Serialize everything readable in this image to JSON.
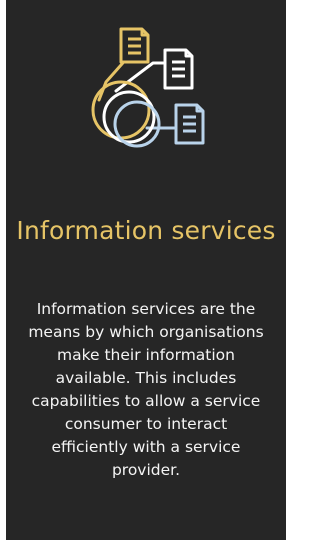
{
  "card": {
    "title": "Information services",
    "description": "Information services are the means by which organisations make their information available. This includes capabilities to allow a service consumer to interact efficiently with a service provider."
  },
  "icon": {
    "name": "information-services-icon",
    "colors": {
      "gold": "#e6c466",
      "white": "#ffffff",
      "light_blue": "#b9d3ea"
    }
  },
  "colors": {
    "background": "#262626",
    "title": "#e6c466",
    "text": "#f4f4f4"
  }
}
